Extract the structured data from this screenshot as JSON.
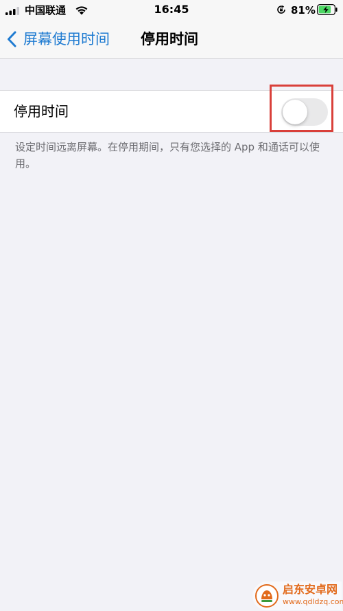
{
  "status_bar": {
    "carrier": "中国联通",
    "time": "16:45",
    "battery_percent": "81%",
    "icons": [
      "signal-icon",
      "wifi-icon",
      "orientation-lock-icon",
      "battery-charging-icon"
    ]
  },
  "nav": {
    "back_label": "屏幕使用时间",
    "title": "停用时间"
  },
  "settings": {
    "downtime_label": "停用时间",
    "downtime_enabled": false
  },
  "footer": {
    "description": "设定时间远离屏幕。在停用期间，只有您选择的 App 和通话可以使用。"
  },
  "watermark": {
    "name": "启东安卓网",
    "url": "www.qdldzq.com"
  },
  "colors": {
    "accent": "#1f7bd1",
    "background": "#f2f2f7",
    "toggle_off": "#e9e9ea",
    "highlight": "#d9403a",
    "footer_text": "#6d6d72",
    "battery": "#4cd964"
  }
}
